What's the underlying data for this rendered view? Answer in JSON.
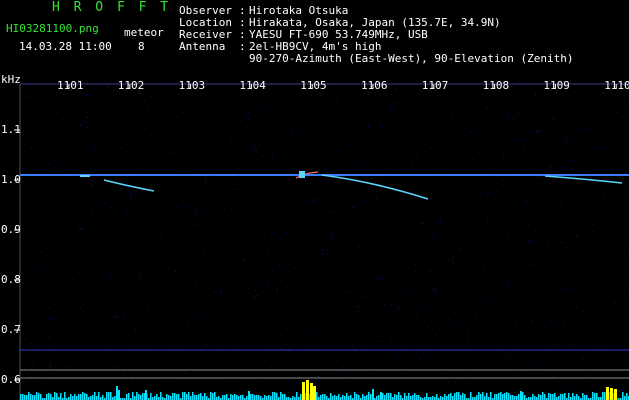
{
  "header": {
    "brand": "H R O F F T",
    "filename": "HI03281100.png",
    "datetime": "14.03.28 11:00",
    "meteor_label": "meteor",
    "meteor_count": "8"
  },
  "station": [
    {
      "key": "Observer",
      "value": "Hirotaka Otsuka"
    },
    {
      "key": "Location",
      "value": "Hirakata, Osaka, Japan (135.7E, 34.9N)"
    },
    {
      "key": "Receiver",
      "value": "YAESU FT-690 53.749MHz, USB"
    },
    {
      "key": "Antenna",
      "value": "2el-HB9CV, 4m's high"
    },
    {
      "key": "",
      "value": "90-270-Azimuth (East-West), 90-Elevation (Zenith)"
    }
  ],
  "axes": {
    "y_unit": "kHz",
    "x_ticks": [
      "1101",
      "1102",
      "1103",
      "1104",
      "1105",
      "1106",
      "1107",
      "1108",
      "1109",
      "1110"
    ],
    "y_ticks": [
      "1.1",
      "1.0",
      "0.9",
      "0.8",
      "0.7",
      "0.6"
    ]
  },
  "colors": {
    "brand": "#35e335",
    "background": "#000000",
    "noise": "#1818a0",
    "carrier": "#3a7cff",
    "echo": "#5ad6ff",
    "activity_bar": "#00e5ff",
    "activity_peak": "#ffff00"
  }
}
